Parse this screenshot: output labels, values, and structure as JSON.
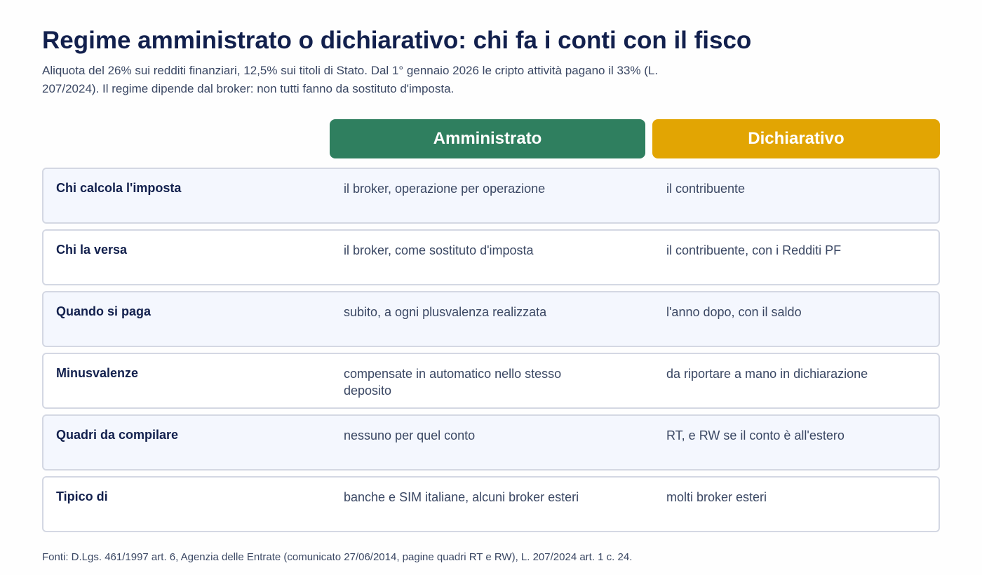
{
  "title": "Regime amministrato o dichiarativo: chi fa i conti con il fisco",
  "subtitle": "Aliquota del 26% sui redditi finanziari, 12,5% sui titoli di Stato. Dal 1° gennaio 2026 le cripto attività pagano il 33% (L. 207/2024). Il regime dipende dal broker: non tutti fanno da sostituto d'imposta.",
  "columns": {
    "amministrato": {
      "label": "Amministrato",
      "color": "#2f7f5f"
    },
    "dichiarativo": {
      "label": "Dichiarativo",
      "color": "#e2a503"
    }
  },
  "rows": [
    {
      "label": "Chi calcola l'imposta",
      "amministrato": "il broker, operazione per operazione",
      "dichiarativo": "il contribuente"
    },
    {
      "label": "Chi la versa",
      "amministrato": "il broker, come sostituto d'imposta",
      "dichiarativo": "il contribuente, con i Redditi PF"
    },
    {
      "label": "Quando si paga",
      "amministrato": "subito, a ogni plusvalenza realizzata",
      "dichiarativo": "l'anno dopo, con il saldo"
    },
    {
      "label": "Minusvalenze",
      "amministrato": "compensate in automatico nello stesso deposito",
      "dichiarativo": "da riportare a mano in dichiarazione"
    },
    {
      "label": "Quadri da compilare",
      "amministrato": "nessuno per quel conto",
      "dichiarativo": "RT, e RW se il conto è all'estero"
    },
    {
      "label": "Tipico di",
      "amministrato": "banche e SIM italiane, alcuni broker esteri",
      "dichiarativo": "molti broker esteri"
    }
  ],
  "sources": "Fonti: D.Lgs. 461/1997 art. 6, Agenzia delle Entrate (comunicato 27/06/2014, pagine quadri RT e RW), L. 207/2024 art. 1 c. 24."
}
